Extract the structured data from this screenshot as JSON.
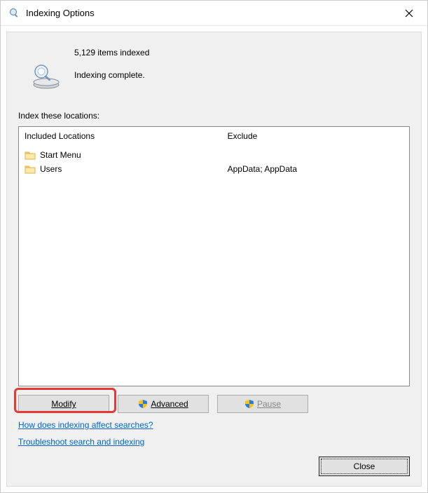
{
  "window": {
    "title": "Indexing Options"
  },
  "status": {
    "count_text": "5,129 items indexed",
    "state_text": "Indexing complete."
  },
  "section_label": "Index these locations:",
  "columns": {
    "included_header": "Included Locations",
    "exclude_header": "Exclude"
  },
  "rows": [
    {
      "name": "Start Menu",
      "exclude": ""
    },
    {
      "name": "Users",
      "exclude": "AppData; AppData"
    }
  ],
  "buttons": {
    "modify": "Modify",
    "advanced": "Advanced",
    "pause": "Pause",
    "close": "Close"
  },
  "links": {
    "how": "How does indexing affect searches?",
    "troubleshoot": "Troubleshoot search and indexing"
  }
}
